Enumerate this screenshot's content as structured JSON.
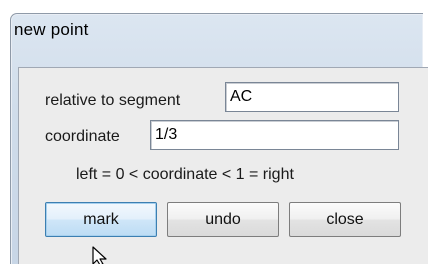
{
  "window": {
    "title": "new point"
  },
  "form": {
    "segment_label": "relative to segment",
    "segment_value": "AC",
    "coordinate_label": "coordinate",
    "coordinate_value": "1/3",
    "hint": "left = 0  <  coordinate  <  1 = right"
  },
  "buttons": {
    "mark": "mark",
    "undo": "undo",
    "close": "close"
  }
}
